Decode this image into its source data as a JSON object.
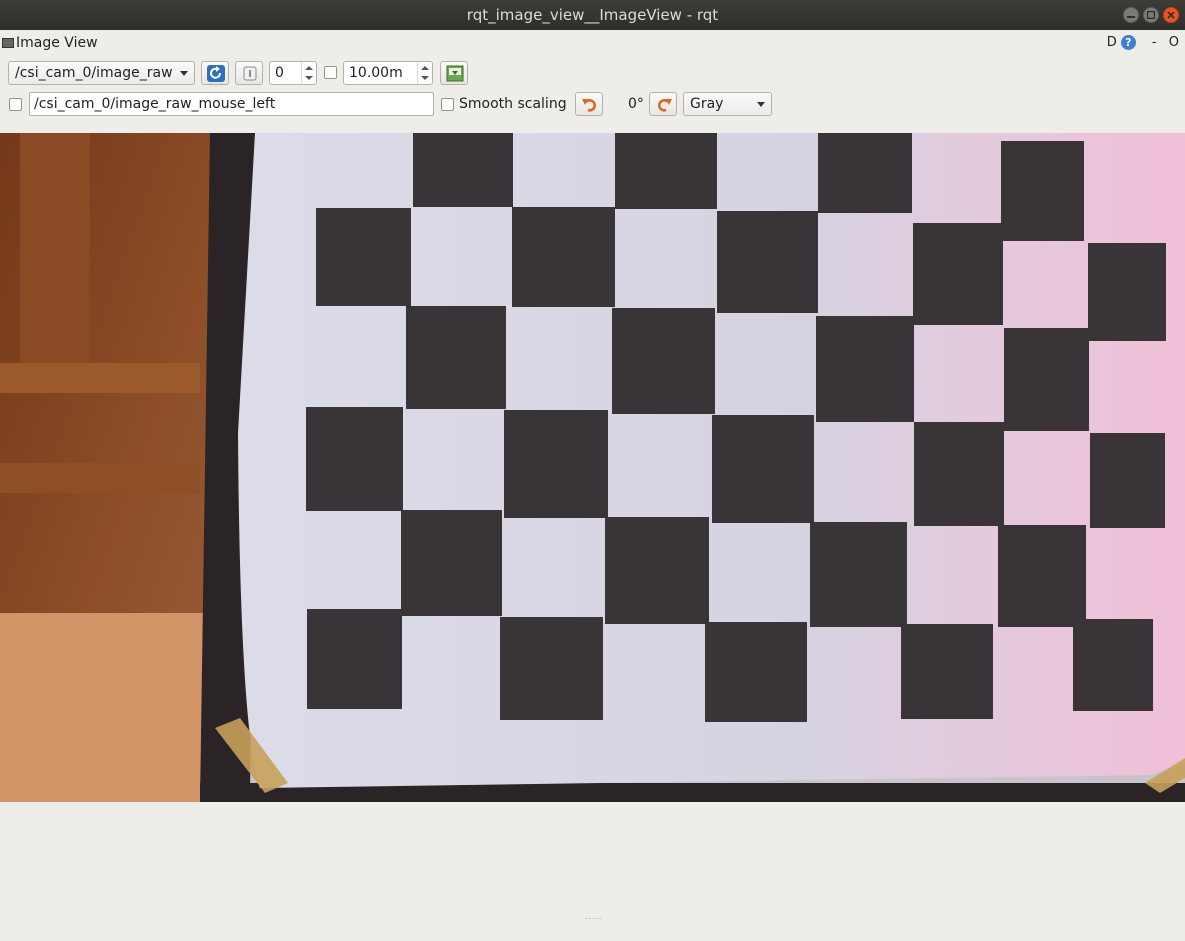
{
  "window": {
    "title": "rqt_image_view__ImageView - rqt"
  },
  "panel": {
    "title": "Image View",
    "right_flags": [
      "D",
      "?",
      "-",
      "O"
    ]
  },
  "toolbar": {
    "topic": "/csi_cam_0/image_raw",
    "frame_value": "0",
    "timeout_value": "10.00m",
    "publish_topic": "/csi_cam_0/image_raw_mouse_left",
    "smooth_scaling_label": "Smooth scaling",
    "rotation_label": "0°",
    "color_scheme": "Gray",
    "icons": {
      "refresh": "refresh-icon",
      "pause": "pause-icon",
      "save": "save-image-icon",
      "rotate_left": "rotate-left-icon",
      "rotate_right": "rotate-right-icon"
    }
  },
  "colors": {
    "titlebar": "#2f2e2b",
    "window_bg": "#efedea",
    "close_button": "#e9541f",
    "accent_icon": "#2d6fc3",
    "rotate_icon": "#e0661b"
  },
  "image": {
    "subject": "camera image of a black and white calibration checkerboard"
  }
}
